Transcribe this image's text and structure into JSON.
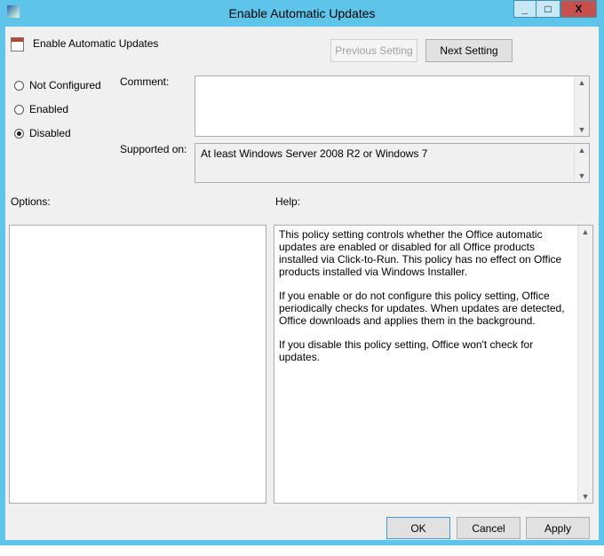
{
  "window": {
    "title": "Enable Automatic Updates",
    "minimize": "_",
    "maximize": "□",
    "close": "X"
  },
  "header": {
    "title": "Enable Automatic Updates",
    "previous_label": "Previous Setting",
    "next_label": "Next Setting"
  },
  "state": {
    "options": [
      "Not Configured",
      "Enabled",
      "Disabled"
    ],
    "selected": "Disabled"
  },
  "comment": {
    "label": "Comment:",
    "value": ""
  },
  "supported": {
    "label": "Supported on:",
    "value": "At least Windows Server 2008 R2 or Windows 7"
  },
  "options_label": "Options:",
  "help": {
    "label": "Help:",
    "paragraphs": [
      "This policy setting controls whether the Office automatic updates are enabled or disabled for all Office products installed via Click-to-Run. This policy has no effect on Office products installed via Windows Installer.",
      "If you enable or do not configure this policy setting, Office periodically checks for updates. When updates are detected, Office downloads and applies them in the background.",
      "If you disable this policy setting, Office won't check for updates."
    ]
  },
  "footer": {
    "ok": "OK",
    "cancel": "Cancel",
    "apply": "Apply"
  }
}
